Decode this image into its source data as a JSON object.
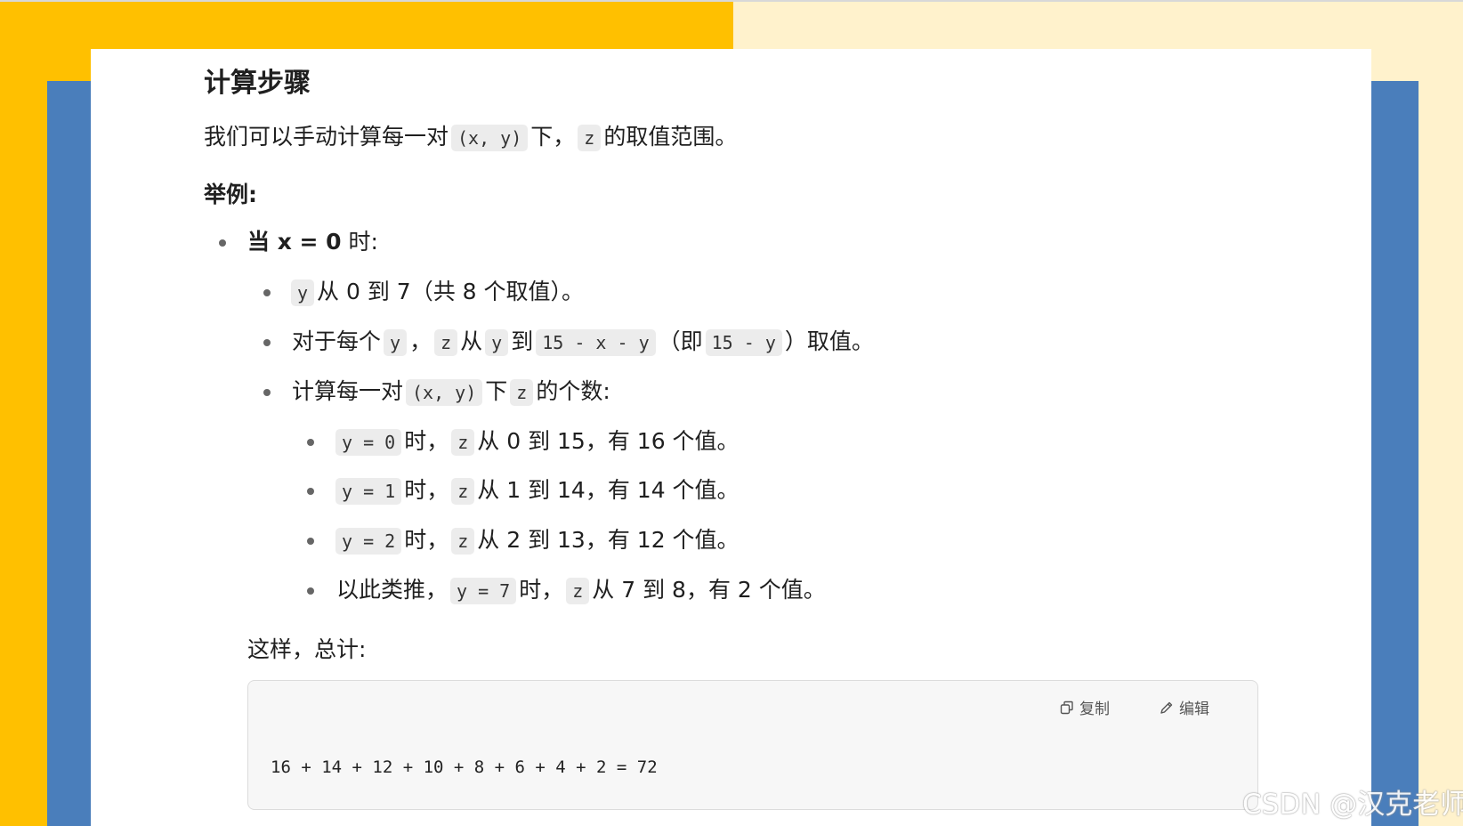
{
  "heading": "计算步骤",
  "intro": {
    "a": "我们可以手动计算每一对",
    "code1": "(x, y)",
    "b": "下，",
    "code2": "z",
    "c": "的取值范围。"
  },
  "example_label": "举例:",
  "l1": {
    "bold": "当 x = 0",
    "rest": "时:"
  },
  "l2": {
    "code": "y",
    "text": "从 0 到 7（共 8 个取值）。"
  },
  "l3": {
    "a": "对于每个",
    "c1": "y",
    "b": "，",
    "c2": "z",
    "c": "从",
    "c3": "y",
    "d": "到",
    "c4": "15 - x - y",
    "e": "（即",
    "c5": "15 - y",
    "f": "）取值。"
  },
  "l4": {
    "a": "计算每一对",
    "c1": "(x, y)",
    "b": "下",
    "c2": "z",
    "c": "的个数:"
  },
  "sub": [
    {
      "code": "y = 0",
      "mid": "时，",
      "code2": "z",
      "text": "从 0 到 15，有 16 个值。"
    },
    {
      "code": "y = 1",
      "mid": "时，",
      "code2": "z",
      "text": "从 1 到 14，有 14 个值。"
    },
    {
      "code": "y = 2",
      "mid": "时，",
      "code2": "z",
      "text": "从 2 到 13，有 12 个值。"
    },
    {
      "pre": "以此类推，",
      "code": "y = 7",
      "mid": "时，",
      "code2": "z",
      "text": "从 7 到 8，有 2 个值。"
    }
  ],
  "summary": "这样，总计:",
  "codebox": {
    "copy_label": "复制",
    "edit_label": "编辑",
    "code": "16 + 14 + 12 + 10 + 8 + 6 + 4 + 2 = 72"
  },
  "watermark": "CSDN @汉克老师",
  "colors": {
    "left_bg": "#FFC000",
    "right_bg": "#FFF2CC",
    "side_bar": "#4A7EBB"
  }
}
